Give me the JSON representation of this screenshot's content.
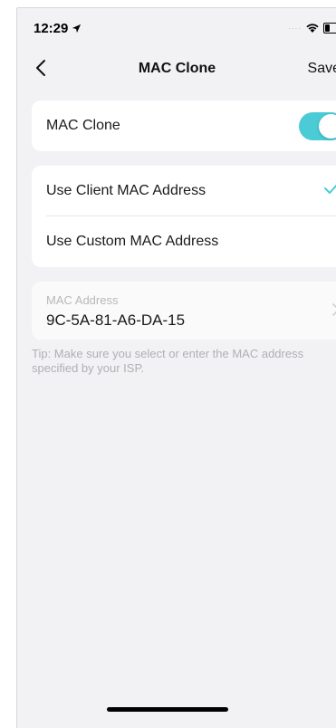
{
  "status_bar": {
    "time": "12:29",
    "location_icon": "location-arrow-icon",
    "wifi_icon": "wifi-icon",
    "battery_icon": "battery-icon"
  },
  "nav": {
    "title": "MAC Clone",
    "save_label": "Save",
    "back_icon": "chevron-left-icon"
  },
  "mac_clone_toggle": {
    "label": "MAC Clone",
    "enabled": true
  },
  "options": [
    {
      "label": "Use Client MAC Address",
      "selected": true
    },
    {
      "label": "Use Custom MAC Address",
      "selected": false
    }
  ],
  "mac_address": {
    "label": "MAC Address",
    "value": "9C-5A-81-A6-DA-15"
  },
  "tip": "Tip: Make sure you select or enter the MAC address specified by your ISP.",
  "colors": {
    "accent": "#4acbd6",
    "background": "#f2f2f5",
    "card": "#ffffff",
    "muted_text": "#b0b0b5"
  }
}
